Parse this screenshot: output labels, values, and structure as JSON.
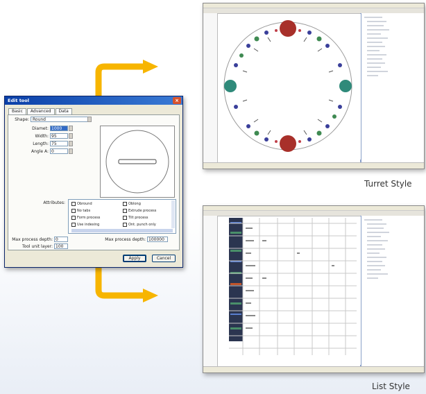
{
  "dialog": {
    "title": "Edit tool",
    "close_glyph": "×",
    "tabs": [
      "Basic",
      "Advanced",
      "Data"
    ],
    "active_tab": "Basic",
    "shape_label": "Shape:",
    "shape_value": "Round",
    "fields": [
      {
        "label": "Diamet:",
        "value": "1000",
        "selected": true
      },
      {
        "label": "Width:",
        "value": "95"
      },
      {
        "label": "Length:",
        "value": "75"
      },
      {
        "label": "Angle A:",
        "value": "0"
      }
    ],
    "attributes_label": "Attributes:",
    "attributes": [
      {
        "label": "Obround",
        "checked": false
      },
      {
        "label": "Oblong",
        "checked": false
      },
      {
        "label": "No tabs",
        "checked": false
      },
      {
        "label": "Extrude process",
        "checked": false
      },
      {
        "label": "Form process",
        "checked": false
      },
      {
        "label": "Tilt process",
        "checked": false
      },
      {
        "label": "Use indexing",
        "checked": false
      },
      {
        "label": "Ont. punch only",
        "checked": false
      }
    ],
    "max_process_depth_label": "Max process depth:",
    "max_process_depth_value": "0",
    "max_process_depth2_label": "Max process depth:",
    "max_process_depth2_value": "100000",
    "tool_unit_label": "Tool unit layer:",
    "tool_unit_value": "100",
    "ok_label": "Apply",
    "cancel_label": "Cancel"
  },
  "captions": {
    "turret": "Turret Style",
    "list": "List Style"
  },
  "colors": {
    "arrow": "#f7b500",
    "turret_large_red": "#a8302a",
    "turret_large_teal": "#2f8a7a",
    "turret_small_blue": "#3a3f9a",
    "turret_small_green": "#3f8a52"
  }
}
